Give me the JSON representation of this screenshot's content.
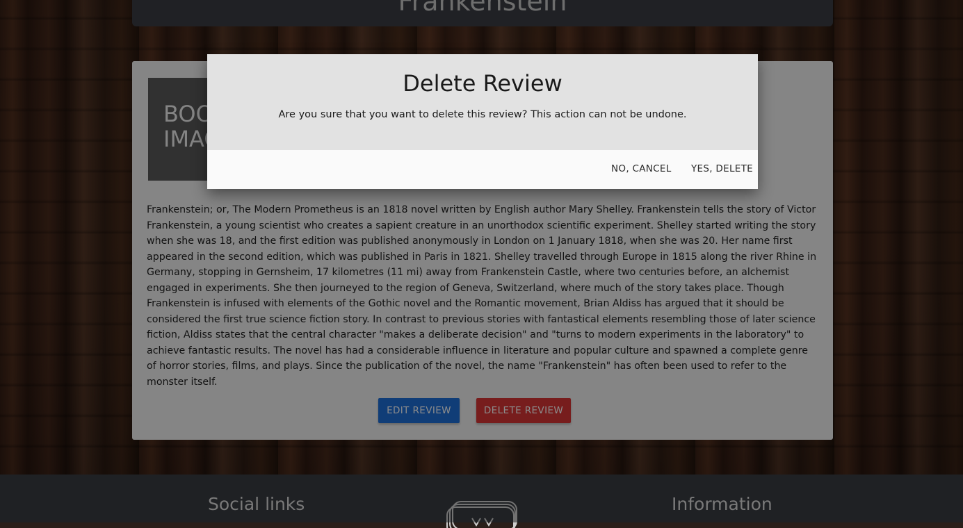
{
  "page": {
    "title": "Frankenstein"
  },
  "book": {
    "image_placeholder": "BOOK IMAGE",
    "description": "Frankenstein; or, The Modern Prometheus is an 1818 novel written by English author Mary Shelley. Frankenstein tells the story of Victor Frankenstein, a young scientist who creates a sapient creature in an unorthodox scientific experiment. Shelley started writing the story when she was 18, and the first edition was published anonymously in London on 1 January 1818, when she was 20. Her name first appeared in the second edition, which was published in Paris in 1821. Shelley travelled through Europe in 1815 along the river Rhine in Germany, stopping in Gernsheim, 17 kilometres (11 mi) away from Frankenstein Castle, where two centuries before, an alchemist engaged in experiments. She then journeyed to the region of Geneva, Switzerland, where much of the story takes place. Though Frankenstein is infused with elements of the Gothic novel and the Romantic movement, Brian Aldiss has argued that it should be considered the first true science fiction story. In contrast to previous stories with fantastical elements resembling those of later science fiction, Aldiss states that the central character \"makes a deliberate decision\" and \"turns to modern experiments in the laboratory\" to achieve fantastic results. The novel has had a considerable influence in literature and popular culture and spawned a complete genre of horror stories, films, and plays. Since the publication of the novel, the name \"Frankenstein\" has often been used to refer to the monster itself."
  },
  "actions": {
    "edit_label": "EDIT REVIEW",
    "delete_label": "DELETE REVIEW"
  },
  "footer": {
    "social_title": "Social links",
    "info_title": "Information"
  },
  "modal": {
    "title": "Delete Review",
    "message": "Are you sure that you want to delete this review? This action can not be undone.",
    "cancel_label": "NO, CANCEL",
    "confirm_label": "YES, DELETE"
  },
  "colors": {
    "edit_button": "#1e6fd9",
    "delete_button": "#d93535",
    "footer_bg": "#3a3c42",
    "modal_bg": "#e2e2e2"
  }
}
